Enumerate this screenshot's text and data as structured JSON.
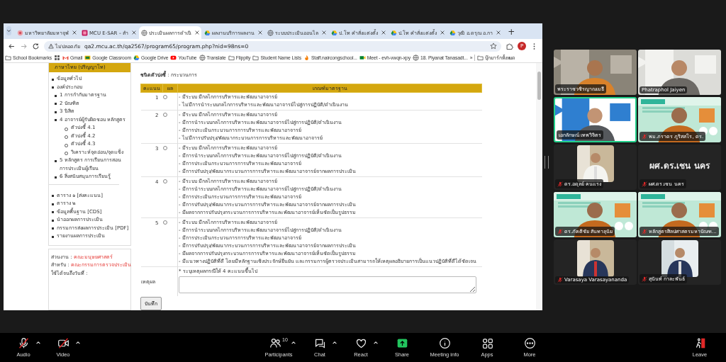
{
  "browser": {
    "tabs": [
      {
        "title": "มหาวิทยาลัยมหาจุฬ",
        "kind": "seal",
        "selected": false
      },
      {
        "title": "MCU E-SAR – สำ",
        "kind": "mcu",
        "selected": false
      },
      {
        "title": "ประเมินผลการดำเนิ",
        "kind": "globe",
        "selected": true
      },
      {
        "title": "ผลงานบริการผลงาน",
        "kind": "drive",
        "selected": false
      },
      {
        "title": "ระบบประเมินออนไล",
        "kind": "globe",
        "selected": false
      },
      {
        "title": "ป.โท คำสั่งแต่งตั้ง",
        "kind": "drive",
        "selected": false
      },
      {
        "title": "ป.โท คำสั่งแต่งตั้ง",
        "kind": "drive",
        "selected": false
      },
      {
        "title": "วุฒิ อ.ดรุณ อ.กา",
        "kind": "drive",
        "selected": false
      }
    ],
    "new_tab": "+",
    "security_label": "ไม่ปลอดภัย",
    "url": "qa2.mcu.ac.th/qa2567/program65/program.php?nid=98ns=0",
    "profile_initial": "P",
    "bookmarks": [
      {
        "label": "School Bookmarks",
        "kind": "folder"
      },
      {
        "kind": "grid"
      },
      {
        "label": "Gmail",
        "kind": "mail"
      },
      {
        "label": "Google Classroom",
        "kind": "classroom"
      },
      {
        "label": "Google Drive",
        "kind": "drive"
      },
      {
        "label": "YouTube",
        "kind": "youtube"
      },
      {
        "label": "Translate",
        "kind": "globe"
      },
      {
        "label": "Flippity",
        "kind": "folder"
      },
      {
        "label": "Student Name Lists",
        "kind": "folder"
      },
      {
        "label": "Staff.naircongschool...",
        "kind": "flame"
      },
      {
        "label": "Meet - evh-vwqn-xpy",
        "kind": "meet"
      },
      {
        "label": "18. Piyanat Tanasadt...",
        "kind": "globe"
      }
    ],
    "more_bookmarks": "»",
    "all_bookmarks": "บุ๊กมาร์กทั้งหมด"
  },
  "page": {
    "sidebar": {
      "header": "ภาษาไทย (ปริญญาโท)",
      "tree": [
        {
          "label": "ข้อมูลทั่วไป"
        },
        {
          "label": "องค์ประกอบ",
          "children": [
            {
              "label": "1 การกำกับมาตรฐาน"
            },
            {
              "label": "2 บัณฑิต"
            },
            {
              "label": "3 นิสิต"
            },
            {
              "label": "4 อาจารย์ผู้รับผิดชอบ หลักสูตร",
              "children": [
                {
                  "label": "ตัวบ่งชี้ 4.1"
                },
                {
                  "label": "ตัวบ่งชี้ 4.2"
                },
                {
                  "label": "ตัวบ่งชี้ 4.3"
                },
                {
                  "label": "วิเคราะห์จุดอ่อน/จุดแข็ง"
                }
              ]
            },
            {
              "label": "5 หลักสูตร การเรียนการสอน การประเมินผู้เรียน"
            },
            {
              "label": "6 สิ่งสนับสนุนการเรียนรู้"
            }
          ]
        }
      ],
      "links": [
        "ตาราง ๑ [ส่งคะแนน]",
        "ตาราง ๒",
        "ข้อมูลพื้นฐาน [CDS]",
        "นำออกผลการประเมิน",
        "กรรมการส่งผลการประเมิน [PDF]",
        "รายงานผลการประเมิน"
      ],
      "unit_label": "ส่วนงาน :",
      "unit": "คณะมนุษยศาสตร์",
      "for_label": "สำหรับ :",
      "for_value": "คณะกรรมการตรวจประเมิน",
      "valid_until_label": "ใช้ได้จนถึงวันที่ :"
    },
    "indicator_type": "**ชนิดตัวบ่งชี้** : กระบวนการ",
    "table": {
      "columns": [
        "คะแนน",
        "ผล",
        "เกณฑ์มาตรฐาน"
      ],
      "rows": [
        {
          "score": "1",
          "selected": false,
          "criteria": [
            "- มีระบบ มีกลไกการบริหารและพัฒนาอาจารย์",
            "- ไม่มีการนำระบบกลไกการบริหารและพัฒนาอาจารย์ไปสู่การปฏิบัติ/ดำเนินงาน"
          ]
        },
        {
          "score": "2",
          "selected": false,
          "criteria": [
            "- มีระบบ มีกลไกการบริหารและพัฒนาอาจารย์",
            "- มีการนำระบบกลไกการบริหารและพัฒนาอาจารย์ไปสู่การปฏิบัติ/ดำเนินงาน",
            "- มีการประเมินกระบวนการการบริหารและพัฒนาอาจารย์",
            "- ไม่มีการปรับปรุง/พัฒนากระบวนการการบริหารและพัฒนาอาจารย์"
          ]
        },
        {
          "score": "3",
          "selected": false,
          "criteria": [
            "- มีระบบ มีกลไกการบริหารและพัฒนาอาจารย์",
            "- มีการนำระบบกลไกการบริหารและพัฒนาอาจารย์ไปสู่การปฏิบัติ/ดำเนินงาน",
            "- มีการประเมินกระบวนการการบริหารและพัฒนาอาจารย์",
            "- มีการปรับปรุง/พัฒนากระบวนการการบริหารและพัฒนาอาจารย์จากผลการประเมิน"
          ]
        },
        {
          "score": "4",
          "selected": false,
          "criteria": [
            "- มีระบบ มีกลไกการบริหารและพัฒนาอาจารย์",
            "- มีการนำระบบกลไกการบริหารและพัฒนาอาจารย์ไปสู่การปฏิบัติ/ดำเนินงาน",
            "- มีการประเมินกระบวนการการบริหารและพัฒนาอาจารย์",
            "- มีการปรับปรุง/พัฒนากระบวนการการบริหารและพัฒนาอาจารย์จากผลการประเมิน",
            "- มีผลจากการปรับปรุงกระบวนการการบริหารและพัฒนาอาจารย์เห็นชัดเป็นรูปธรรม"
          ]
        },
        {
          "score": "5",
          "selected": false,
          "criteria": [
            "- มีระบบ มีกลไกการบริหารและพัฒนาอาจารย์",
            "- มีการนำระบบกลไกการบริหารและพัฒนาอาจารย์ไปสู่การปฏิบัติ/ดำเนินงาน",
            "- มีการประเมินกระบวนการการบริหารและพัฒนาอาจารย์",
            "- มีการปรับปรุง/พัฒนากระบวนการการบริหารและพัฒนาอาจารย์จากผลการประเมิน",
            "- มีผลจากการปรับปรุงกระบวนการการบริหารและพัฒนาอาจารย์เห็นชัดเป็นรูปธรรม",
            "- มีแนวทางปฏิบัติที่ดี โดยมีหลักฐานเชิงประจักษ์ยืนยัน และกรรมการผู้ตรวจประเมินสามารถให้เหตุผลอธิบายการเป็นแนวปฏิบัติที่ดีได้ชัดเจน"
          ]
        }
      ],
      "reason_label": "เหตุผล",
      "reason_hint": "* ระบุเหตุผลกรณีให้ 4 คะแนนขึ้นไป"
    },
    "save_button": "บันทึก"
  },
  "participants": [
    {
      "name": "พระราชวชิรญาณเมธี",
      "muted": false,
      "speaking": false,
      "kind": "camera"
    },
    {
      "name": "Phatraphol Jaiyen",
      "muted": false,
      "speaking": false,
      "kind": "camera"
    },
    {
      "name": "เอกลักษณ์ เทพวิจิตร",
      "muted": false,
      "speaking": true,
      "kind": "camera"
    },
    {
      "name": "พม.ภราดร ภูริสสโร, ดร.",
      "muted": true,
      "speaking": false,
      "kind": "banner"
    },
    {
      "name": "ดร.อดุลย์ คนแรง",
      "muted": true,
      "speaking": false
    },
    {
      "name": "ผศ.ดร.เชน นคร",
      "muted": true,
      "speaking": false,
      "kind": "name",
      "display_name": "ผศ.ดร.เชน นคร"
    },
    {
      "name": "ดร.ภัคติชัย สันทาลุนัย",
      "muted": true,
      "speaking": false,
      "kind": "banner"
    },
    {
      "name": "หลักสูตรศิลปศาสตรมหาบัณฑ...",
      "muted": true,
      "speaking": false,
      "kind": "banner"
    },
    {
      "name": "Varasaya Varasayananda",
      "muted": true,
      "speaking": false
    },
    {
      "name": "สุนันท์ กาละพันธ์",
      "muted": true,
      "speaking": false
    }
  ],
  "toolbar": [
    {
      "label": "Audio",
      "kind": "audio",
      "on": false,
      "menu": true
    },
    {
      "label": "Video",
      "kind": "video",
      "on": false,
      "menu": true
    },
    {
      "label": "Participants",
      "kind": "participants",
      "count": "10",
      "menu": true
    },
    {
      "label": "Chat",
      "kind": "chat",
      "menu": true
    },
    {
      "label": "React",
      "kind": "react",
      "menu": true
    },
    {
      "label": "Share",
      "kind": "share",
      "menu": false
    },
    {
      "label": "Meeting info",
      "kind": "info",
      "menu": false
    },
    {
      "label": "Apps",
      "kind": "apps",
      "menu": false
    },
    {
      "label": "More",
      "kind": "more",
      "menu": false
    },
    {
      "label": "Leave",
      "kind": "leave",
      "menu": false
    }
  ]
}
